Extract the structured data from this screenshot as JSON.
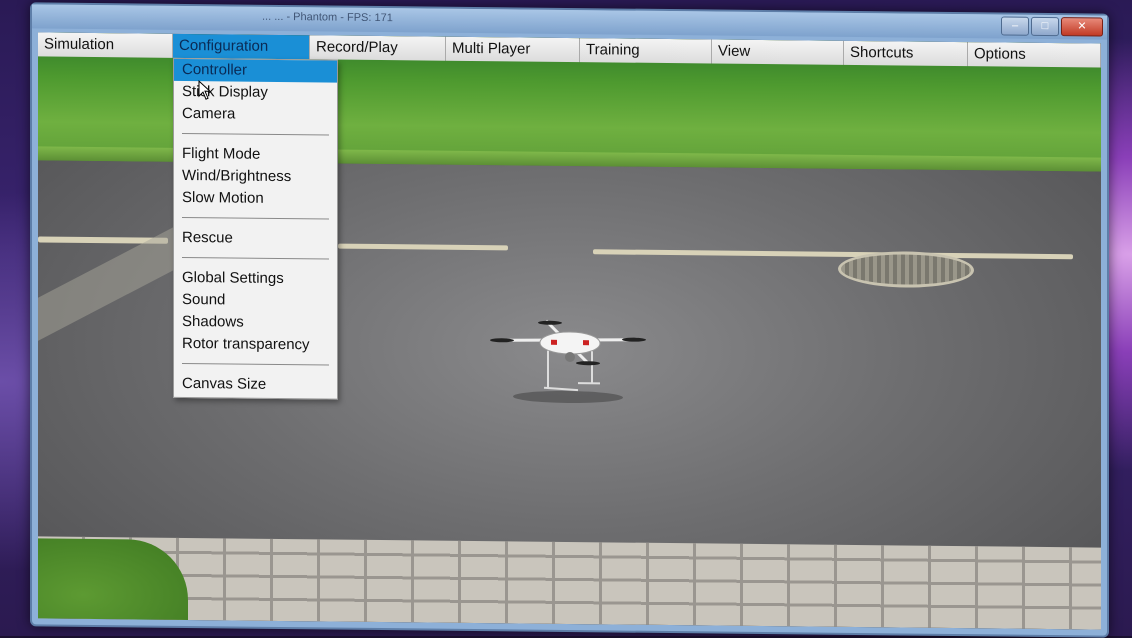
{
  "window": {
    "title": "... ... - Phantom - FPS: 171",
    "controls": [
      "–",
      "□",
      "✕"
    ]
  },
  "menubar": {
    "items": [
      {
        "label": "Simulation"
      },
      {
        "label": "Configuration"
      },
      {
        "label": "Record/Play"
      },
      {
        "label": "Multi Player"
      },
      {
        "label": "Training"
      },
      {
        "label": "View"
      },
      {
        "label": "Shortcuts"
      },
      {
        "label": "Options"
      }
    ],
    "active": "Configuration"
  },
  "dropdown": {
    "groups": [
      [
        "Controller",
        "Stick Display",
        "Camera"
      ],
      [
        "Flight Mode",
        "Wind/Brightness",
        "Slow Motion"
      ],
      [
        "Rescue"
      ],
      [
        "Global Settings",
        "Sound",
        "Shadows",
        "Rotor transparency"
      ],
      [
        "Canvas Size"
      ]
    ],
    "highlighted": "Controller"
  },
  "colors": {
    "menu_highlight": "#1a8fd6",
    "menu_bg": "#f2f2f2",
    "grass": "#4e9a2f",
    "asphalt": "#6e6e70"
  },
  "icons": {
    "cursor": "mouse-pointer-icon",
    "minimize": "minimize-icon",
    "maximize": "maximize-icon",
    "close": "close-icon"
  }
}
